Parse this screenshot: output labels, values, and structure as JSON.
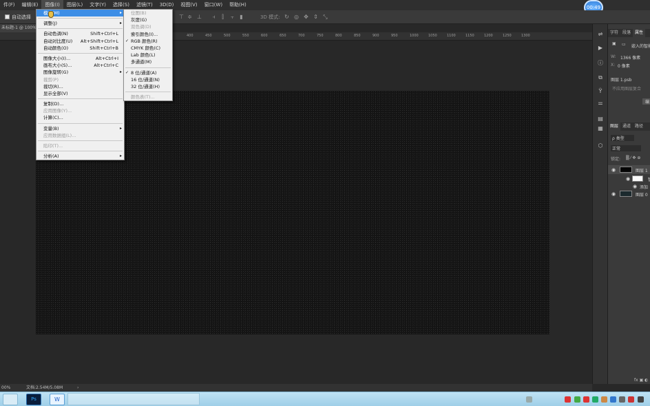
{
  "menubar": {
    "items": [
      "件(F)",
      "编辑(E)",
      "图像(I)",
      "图层(L)",
      "文字(Y)",
      "选择(S)",
      "滤镜(T)",
      "3D(D)",
      "视图(V)",
      "窗口(W)",
      "帮助(H)"
    ]
  },
  "clock": "00:49",
  "options": {
    "auto_select": "自动选择",
    "mode_3d": "3D 模式:"
  },
  "document": {
    "tab": "未标题-1 @ 100%",
    "status_zoom": "00%",
    "status_doc": "文档:2.54M/5.08M"
  },
  "ruler": {
    "ticks": [
      "400",
      "450",
      "500",
      "550",
      "600",
      "650",
      "700",
      "750",
      "800",
      "850",
      "900",
      "950",
      "1000",
      "1050",
      "1100",
      "1150",
      "1200",
      "1250",
      "1300"
    ]
  },
  "image_menu": {
    "items": [
      {
        "label": "模式(M)",
        "submenu": true,
        "highlighted": true
      },
      {
        "sep": true
      },
      {
        "label": "调整(J)",
        "submenu": true
      },
      {
        "sep": true
      },
      {
        "label": "自动色调(N)",
        "shortcut": "Shift+Ctrl+L"
      },
      {
        "label": "自动对比度(U)",
        "shortcut": "Alt+Shift+Ctrl+L"
      },
      {
        "label": "自动颜色(O)",
        "shortcut": "Shift+Ctrl+B"
      },
      {
        "sep": true
      },
      {
        "label": "图像大小(I)...",
        "shortcut": "Alt+Ctrl+I"
      },
      {
        "label": "画布大小(S)...",
        "shortcut": "Alt+Ctrl+C"
      },
      {
        "label": "图像旋转(G)",
        "submenu": true
      },
      {
        "label": "裁剪(P)",
        "disabled": true
      },
      {
        "label": "裁切(R)..."
      },
      {
        "label": "显示全部(V)"
      },
      {
        "sep": true
      },
      {
        "label": "复制(D)..."
      },
      {
        "label": "应用图像(Y)...",
        "disabled": true
      },
      {
        "label": "计算(C)..."
      },
      {
        "sep": true
      },
      {
        "label": "变量(B)",
        "submenu": true
      },
      {
        "label": "应用数据组(L)...",
        "disabled": true
      },
      {
        "sep": true
      },
      {
        "label": "陷印(T)...",
        "disabled": true
      },
      {
        "sep": true
      },
      {
        "label": "分析(A)",
        "submenu": true
      }
    ]
  },
  "mode_menu": {
    "items": [
      {
        "label": "位图(B)",
        "disabled": true
      },
      {
        "label": "灰度(G)"
      },
      {
        "label": "双色调(D)",
        "disabled": true
      },
      {
        "label": "索引颜色(I)..."
      },
      {
        "label": "RGB 颜色(R)",
        "checked": true
      },
      {
        "label": "CMYK 颜色(C)"
      },
      {
        "label": "Lab 颜色(L)"
      },
      {
        "label": "多通道(M)"
      },
      {
        "sep": true
      },
      {
        "label": "8 位/通道(A)",
        "checked": true
      },
      {
        "label": "16 位/通道(N)"
      },
      {
        "label": "32 位/通道(H)"
      },
      {
        "sep": true
      },
      {
        "label": "颜色表(T)...",
        "disabled": true
      }
    ]
  },
  "right_panel": {
    "top_tabs": [
      "字符",
      "段落",
      "属性"
    ],
    "embed_label": "嵌入的智能",
    "w_label": "W:",
    "w_value": "1366 像素",
    "x_label": "X:",
    "x_value": "0 像素",
    "layer_file": "图层 1.psb",
    "replace_hint": "不应用图层复合",
    "edit_btn": "编",
    "layer_tabs": [
      "图层",
      "通道",
      "路径"
    ],
    "filter_kind": "ρ 类型",
    "blend_mode": "正常",
    "lock_label": "锁定:",
    "layers": [
      {
        "name": "图层 1"
      },
      {
        "name": "智"
      },
      {
        "name": "添加"
      },
      {
        "name": "图层 0"
      }
    ]
  },
  "colors": {
    "accent": "#3d8ee6",
    "canvas": "#141414",
    "taskbar": "#bfe3f4"
  }
}
